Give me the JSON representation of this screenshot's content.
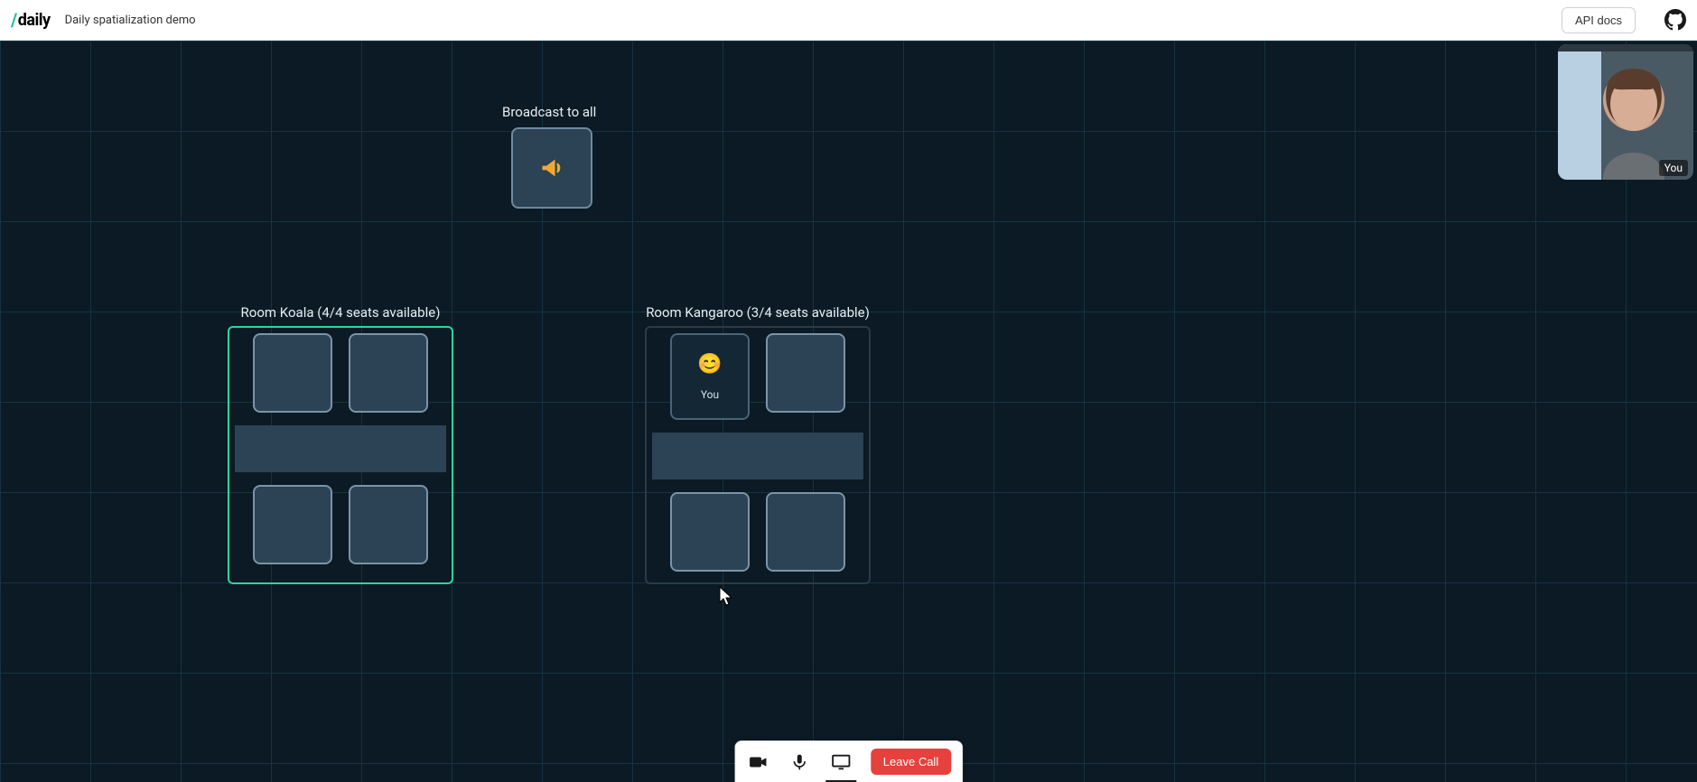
{
  "header": {
    "logo_text": "daily",
    "page_title": "Daily spatialization demo",
    "api_docs_label": "API docs"
  },
  "self_video": {
    "label": "You"
  },
  "broadcast": {
    "label": "Broadcast to all",
    "icon": "megaphone-icon"
  },
  "rooms": [
    {
      "id": "koala",
      "label": "Room Koala (4/4 seats available)",
      "highlighted": true,
      "seats": [
        {
          "occupied": false
        },
        {
          "occupied": false
        },
        {
          "occupied": false
        },
        {
          "occupied": false
        }
      ]
    },
    {
      "id": "kangaroo",
      "label": "Room Kangaroo (3/4 seats available)",
      "highlighted": false,
      "seats": [
        {
          "occupied": true,
          "name": "You",
          "emoji": "😊"
        },
        {
          "occupied": false
        },
        {
          "occupied": false
        },
        {
          "occupied": false
        }
      ]
    }
  ],
  "tray": {
    "camera_icon": "camera-icon",
    "mic_icon": "mic-icon",
    "screen_icon": "screenshare-icon",
    "screen_active": true,
    "leave_label": "Leave Call"
  }
}
